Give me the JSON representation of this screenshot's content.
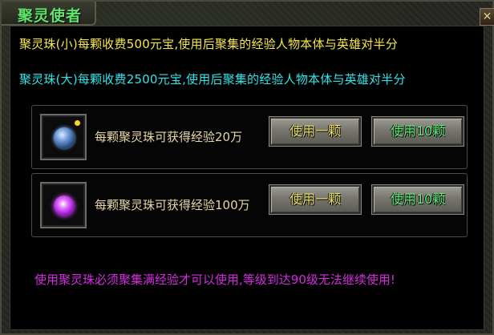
{
  "window": {
    "title": "聚灵使者",
    "close_glyph": "✕"
  },
  "info": {
    "small_pearl_line": "聚灵珠(小)每颗收费500元宝,使用后聚集的经验人物本体与英雄对半分",
    "big_pearl_line": "聚灵珠(大)每颗收费2500元宝,使用后聚集的经验人物本体与英雄对半分"
  },
  "rows": [
    {
      "item_icon": "blue-orb-icon",
      "description": "每颗聚灵珠可获得经验20万",
      "use_one_label": "使用一颗",
      "use_ten_label": "使用10颗"
    },
    {
      "item_icon": "purple-orb-icon",
      "description": "每颗聚灵珠可获得经验100万",
      "use_one_label": "使用一颗",
      "use_ten_label": "使用10颗"
    }
  ],
  "warning": "使用聚灵珠必须聚集满经验才可以使用,等级到达90级无法继续使用!",
  "colors": {
    "title": "#5fe56a",
    "small_line": "#f5e64a",
    "big_line": "#2ee5ea",
    "use_one_text": "#f2e36a",
    "use_ten_text": "#5ff07b",
    "warning": "#d52be0"
  }
}
